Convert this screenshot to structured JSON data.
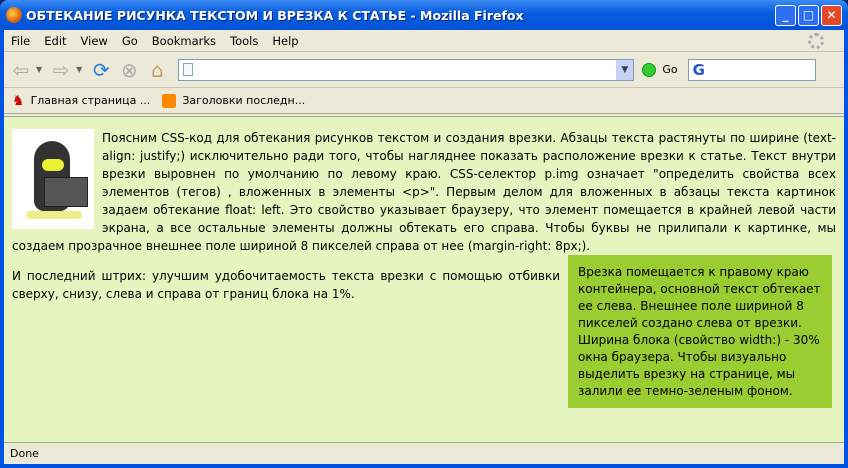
{
  "window": {
    "title": "ОБТЕКАНИЕ РИСУНКА ТЕКСТОМ И ВРЕЗКА К СТАТЬЕ - Mozilla Firefox"
  },
  "menu": [
    "File",
    "Edit",
    "View",
    "Go",
    "Bookmarks",
    "Tools",
    "Help"
  ],
  "toolbar": {
    "url": "",
    "go_label": "Go",
    "search_engine": "G"
  },
  "bookmarks": [
    "Главная страница ...",
    "Заголовки последн..."
  ],
  "content": {
    "para1": "Поясним CSS-код для обтекания рисунков текстом и создания врезки. Абзацы текста растянуты по ширине (text-align: justify;) исключительно ради того, чтобы нагляднее показать расположение врезки к статье. Текст внутри врезки выровнен по умолчанию по левому краю. CSS-селектор p.img означает \"определить свойства всех элементов (тегов) , вложенных в элементы <p>\". Первым делом для вложенных в абзацы текста картинок задаем обтекание float: left. Это свойство указывает браузеру, что элемент помещается в крайней левой части экрана, а все остальные элементы должны обтекать его справа. Чтобы буквы не прилипали к картинке, мы создаем прозрачное внешнее поле шириной 8 пикселей справа от нее (margin-right: 8px;).",
    "aside": "Врезка помещается к правому краю контейнера, основной текст обтекает ее слева. Внешнее поле шириной 8 пикселей создано слева от врезки. Ширина блока (свойство width:) - 30% окна браузера. Чтобы визуально выделить врезку на странице, мы залили ее темно-зеленым фоном.",
    "para2": "И последний штрих: улучшим удобочитаемость текста врезки с помощью отбивки сверху, снизу, слева и справа от границ блока на 1%."
  },
  "status": "Done",
  "colors": {
    "page_bg": "#e6f5c0",
    "aside_bg": "#9acd32"
  }
}
